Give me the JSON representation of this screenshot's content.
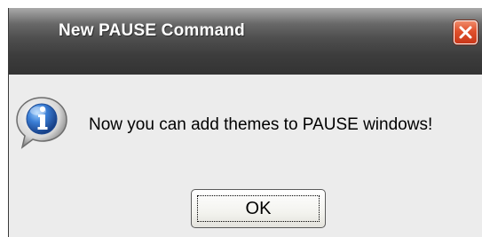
{
  "dialog": {
    "title": "New PAUSE Command",
    "message": "Now you can add themes to PAUSE windows!",
    "ok_label": "OK",
    "close_icon": "close-icon",
    "message_icon": "info-icon"
  },
  "colors": {
    "titlebar": "#4f4f4f",
    "close_button": "#e0502c",
    "body_background": "#ececec",
    "info_icon_blue": "#2a5fb0"
  }
}
